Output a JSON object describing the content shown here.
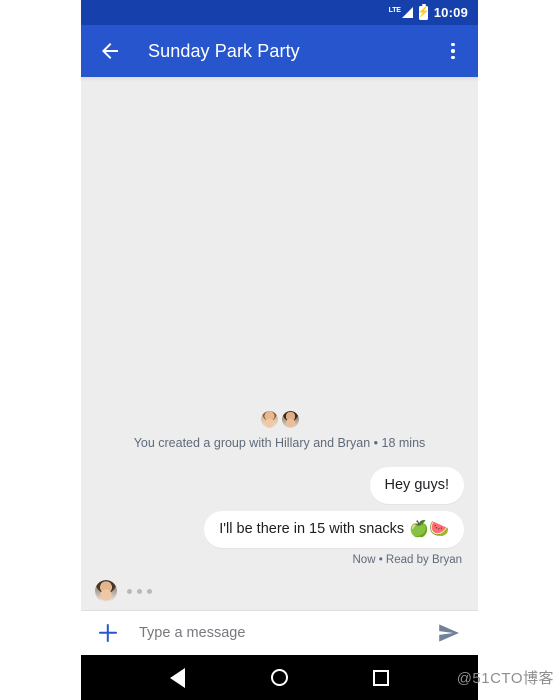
{
  "status_bar": {
    "network_label": "LTE",
    "signal_icon": "signal-bars-icon",
    "battery_icon": "battery-charging-icon",
    "time": "10:09"
  },
  "app_bar": {
    "back_icon": "back-arrow-icon",
    "title": "Sunday Park Party",
    "overflow_icon": "overflow-menu-icon",
    "background_color": "#2655CE"
  },
  "conversation": {
    "group_created": {
      "text": "You created a group with Hillary and Bryan • 18 mins",
      "avatars": [
        "Hillary",
        "Bryan"
      ]
    },
    "messages": [
      {
        "id": "msg-1",
        "text": "Hey guys!",
        "direction": "outgoing",
        "emoji": ""
      },
      {
        "id": "msg-2",
        "text": "I'll be there in 15 with snacks",
        "direction": "outgoing",
        "emoji": "🍏🍉"
      }
    ],
    "delivery_status": "Now • Read by Bryan",
    "typing_indicator": {
      "avatar_name": "Bryan",
      "dots": 3
    },
    "background_color": "#EDEDED"
  },
  "compose": {
    "add_icon": "plus-icon",
    "placeholder": "Type a message",
    "value": "",
    "send_icon": "send-icon",
    "accent_color": "#2655CE"
  },
  "nav_bar": {
    "back_label": "Back",
    "home_label": "Home",
    "recents_label": "Recent apps"
  },
  "watermark": {
    "text": "@51CTO博客"
  }
}
